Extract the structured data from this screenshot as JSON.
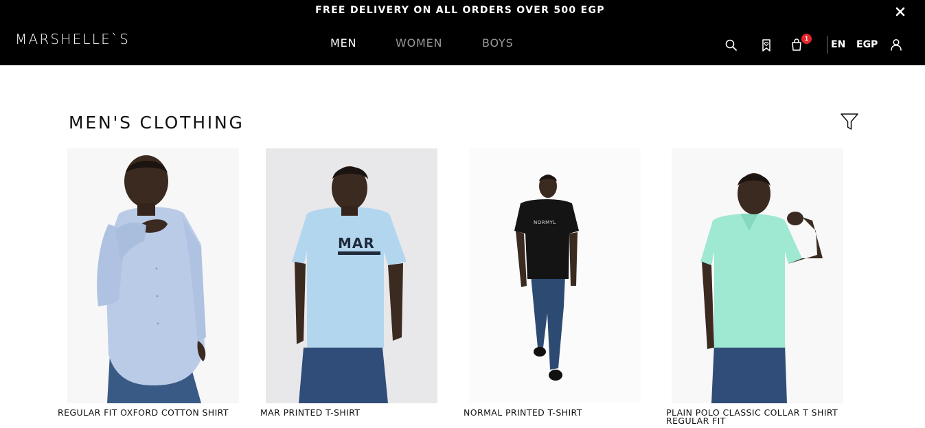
{
  "promo": {
    "text": "FREE DELIVERY ON ALL ORDERS OVER 500 EGP",
    "close_icon": "close-icon"
  },
  "header": {
    "logo": "MARSHELLE`S",
    "nav": [
      {
        "label": "MEN",
        "active": true
      },
      {
        "label": "WOMEN",
        "active": false
      },
      {
        "label": "BOYS",
        "active": false
      }
    ],
    "icons": [
      "search-icon",
      "wishlist-icon",
      "cart-icon",
      "user-icon"
    ],
    "cart_count": "1",
    "language": "EN",
    "currency": "EGP"
  },
  "main": {
    "title": "MEN'S CLOTHING",
    "filter_icon": "filter-icon",
    "products": [
      {
        "name": "REGULAR FIT OXFORD COTTON SHIRT"
      },
      {
        "name": "MAR PRINTED T-SHIRT"
      },
      {
        "name": "NORMAL PRINTED T-SHIRT"
      },
      {
        "name": "PLAIN POLO CLASSIC COLLAR T SHIRT REGULAR FIT"
      }
    ]
  },
  "colors": {
    "header_bg": "#000000",
    "badge": "#e4262b",
    "nav_inactive": "#9b9b9b"
  }
}
